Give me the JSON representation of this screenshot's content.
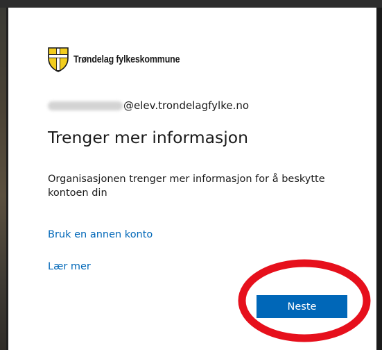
{
  "brand": {
    "logo_text": "Trøndelag fylkeskommune",
    "logo_icon": "shield-cross-icon"
  },
  "identity": {
    "username": "[redacted]",
    "domain": "@elev.trondelagfylke.no"
  },
  "title": "Trenger mer informasjon",
  "description": "Organisasjonen trenger mer informasjon for å beskytte kontoen din",
  "links": {
    "other_account": "Bruk en annen konto",
    "learn_more": "Lær mer"
  },
  "buttons": {
    "next": "Neste"
  },
  "colors": {
    "accent": "#0067b8",
    "annotation": "#e6101c",
    "shield_yellow": "#f2cd1d"
  }
}
